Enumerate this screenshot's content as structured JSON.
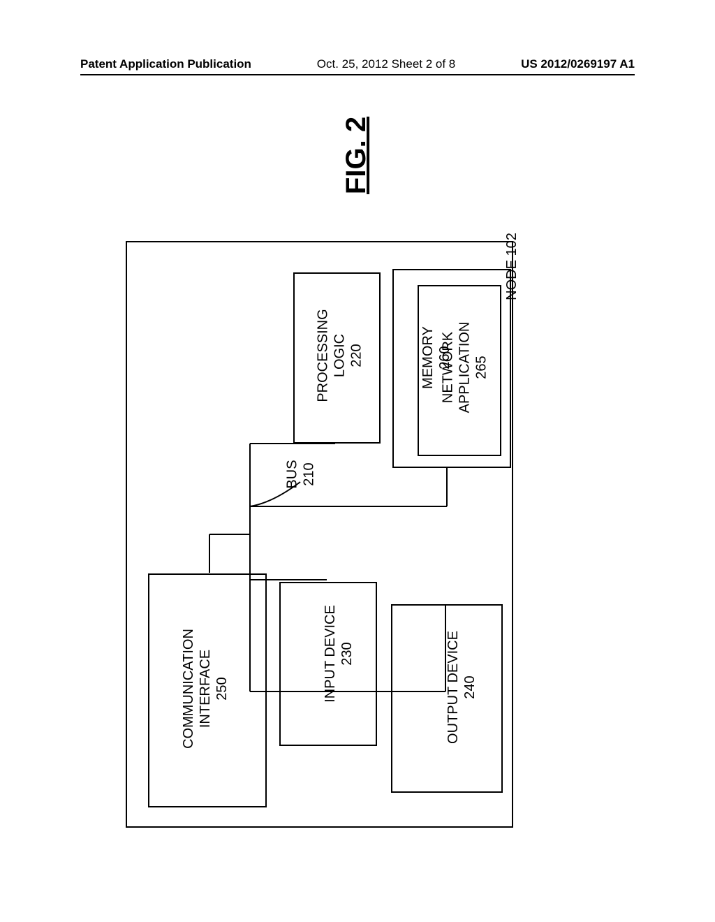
{
  "header": {
    "left": "Patent Application Publication",
    "center": "Oct. 25, 2012  Sheet 2 of 8",
    "right": "US 2012/0269197 A1"
  },
  "figure_label": "FIG. 2",
  "node": {
    "label": "NODE 102"
  },
  "blocks": {
    "communication": {
      "line1": "COMMUNICATION",
      "line2": "INTERFACE",
      "line3": "250"
    },
    "input": {
      "line1": "INPUT DEVICE",
      "line2": "230"
    },
    "output": {
      "line1": "OUTPUT DEVICE",
      "line2": "240"
    },
    "processing": {
      "line1": "PROCESSING",
      "line2": "LOGIC",
      "line3": "220"
    },
    "memory": {
      "line1": "MEMORY",
      "line2": "260"
    },
    "network_app": {
      "line1": "NETWORK",
      "line2": "APPLICATION",
      "line3": "265"
    }
  },
  "bus": {
    "line1": "BUS",
    "line2": "210"
  },
  "chart_data": {
    "type": "diagram",
    "title": "FIG. 2",
    "container": {
      "name": "NODE",
      "ref": "102"
    },
    "components": [
      {
        "name": "BUS",
        "ref": "210"
      },
      {
        "name": "PROCESSING LOGIC",
        "ref": "220"
      },
      {
        "name": "INPUT DEVICE",
        "ref": "230"
      },
      {
        "name": "OUTPUT DEVICE",
        "ref": "240"
      },
      {
        "name": "COMMUNICATION INTERFACE",
        "ref": "250"
      },
      {
        "name": "MEMORY",
        "ref": "260",
        "children": [
          {
            "name": "NETWORK APPLICATION",
            "ref": "265"
          }
        ]
      }
    ],
    "connections": [
      {
        "from": "210",
        "to": "220"
      },
      {
        "from": "210",
        "to": "230"
      },
      {
        "from": "210",
        "to": "240"
      },
      {
        "from": "210",
        "to": "250"
      },
      {
        "from": "210",
        "to": "260"
      }
    ]
  }
}
